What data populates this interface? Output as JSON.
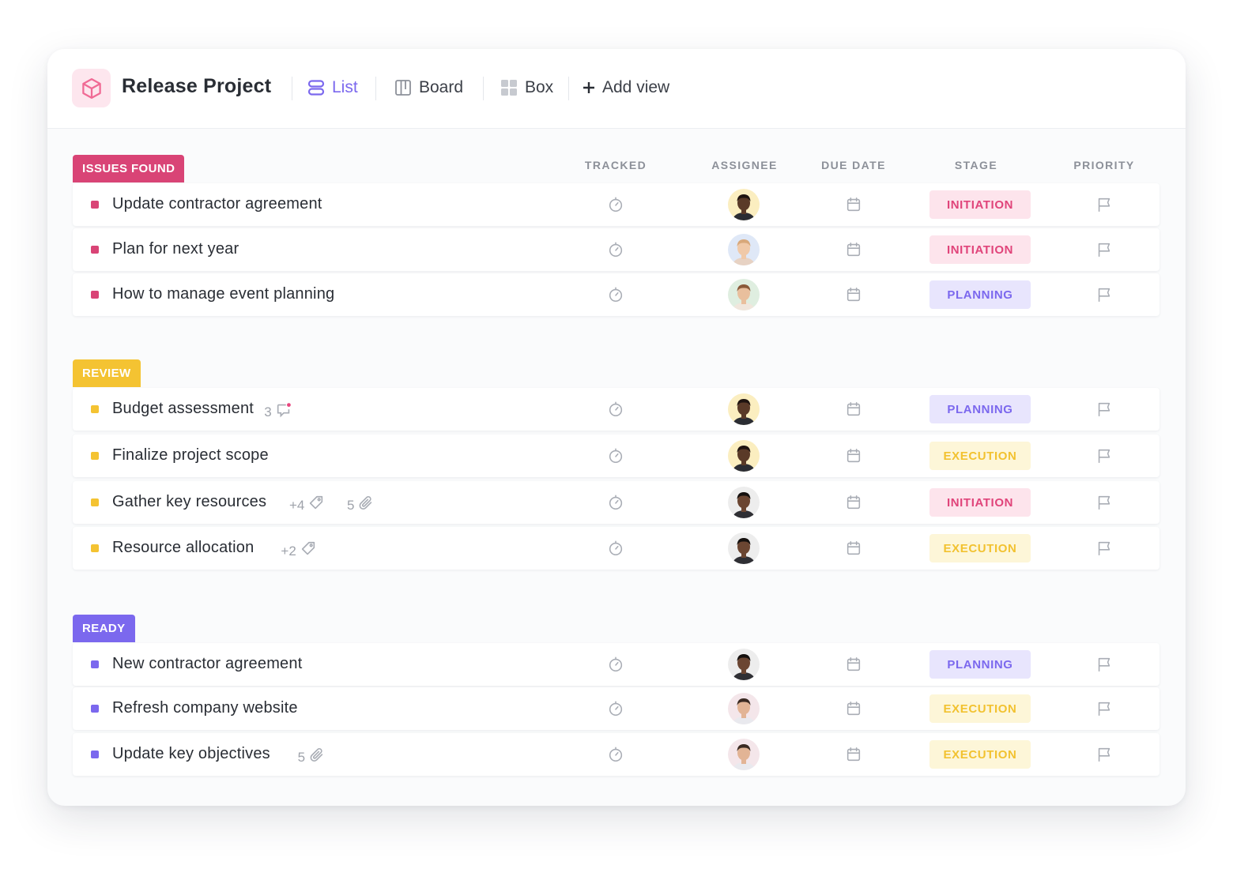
{
  "header": {
    "title": "Release Project",
    "views": [
      {
        "label": "List",
        "icon": "list-icon",
        "active": true
      },
      {
        "label": "Board",
        "icon": "board-icon",
        "active": false
      },
      {
        "label": "Box",
        "icon": "box-icon",
        "active": false
      }
    ],
    "add_view_label": "Add view"
  },
  "columns": {
    "tracked": "TRACKED",
    "assignee": "ASSIGNEE",
    "due_date": "DUE DATE",
    "stage": "STAGE",
    "priority": "PRIORITY"
  },
  "colors": {
    "issues": "#d94476",
    "review": "#f4c332",
    "ready": "#7b68ee",
    "accent": "#7b68ee"
  },
  "groups": [
    {
      "label": "ISSUES FOUND",
      "color_key": "issues",
      "tasks": [
        {
          "name": "Update contractor agreement",
          "stage": "INITIATION",
          "stage_class": "initiation",
          "avatar": "avatar-man-1"
        },
        {
          "name": "Plan for next year",
          "stage": "INITIATION",
          "stage_class": "initiation",
          "avatar": "avatar-woman-1"
        },
        {
          "name": "How to manage event planning",
          "stage": "PLANNING",
          "stage_class": "planning",
          "avatar": "avatar-woman-2"
        }
      ]
    },
    {
      "label": "REVIEW",
      "color_key": "review",
      "tasks": [
        {
          "name": "Budget assessment",
          "stage": "PLANNING",
          "stage_class": "planning",
          "avatar": "avatar-man-1",
          "comments": "3"
        },
        {
          "name": "Finalize project scope",
          "stage": "EXECUTION",
          "stage_class": "execution",
          "avatar": "avatar-man-1"
        },
        {
          "name": "Gather key resources",
          "stage": "INITIATION",
          "stage_class": "initiation",
          "avatar": "avatar-man-2",
          "tags": "+4",
          "attachments": "5"
        },
        {
          "name": "Resource allocation",
          "stage": "EXECUTION",
          "stage_class": "execution",
          "avatar": "avatar-man-2",
          "tags": "+2"
        }
      ]
    },
    {
      "label": "READY",
      "color_key": "ready",
      "tasks": [
        {
          "name": "New contractor agreement",
          "stage": "PLANNING",
          "stage_class": "planning",
          "avatar": "avatar-man-2"
        },
        {
          "name": "Refresh company website",
          "stage": "EXECUTION",
          "stage_class": "execution",
          "avatar": "avatar-man-3"
        },
        {
          "name": "Update key objectives",
          "stage": "EXECUTION",
          "stage_class": "execution",
          "avatar": "avatar-man-3",
          "attachments": "5"
        }
      ]
    }
  ]
}
